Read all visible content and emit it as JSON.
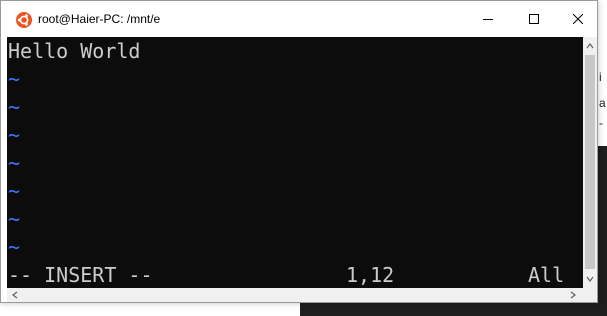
{
  "window": {
    "title": "root@Haier-PC: /mnt/e",
    "app_icon": "ubuntu-icon",
    "buttons": {
      "minimize_icon": "minimize-icon",
      "maximize_icon": "maximize-icon",
      "close_icon": "close-icon"
    }
  },
  "terminal": {
    "lines": [
      "Hello World",
      "~",
      "~",
      "~",
      "~",
      "~",
      "~",
      "~"
    ],
    "status": {
      "mode": "-- INSERT --",
      "position": "1,12",
      "scroll": "All"
    }
  },
  "background": {
    "side_chars": [
      "i",
      "a",
      "-"
    ]
  },
  "colors": {
    "terminal_bg": "#0c0c0c",
    "text": "#cccccc",
    "tilde": "#3b78ff",
    "ubuntu_orange": "#e95420"
  }
}
